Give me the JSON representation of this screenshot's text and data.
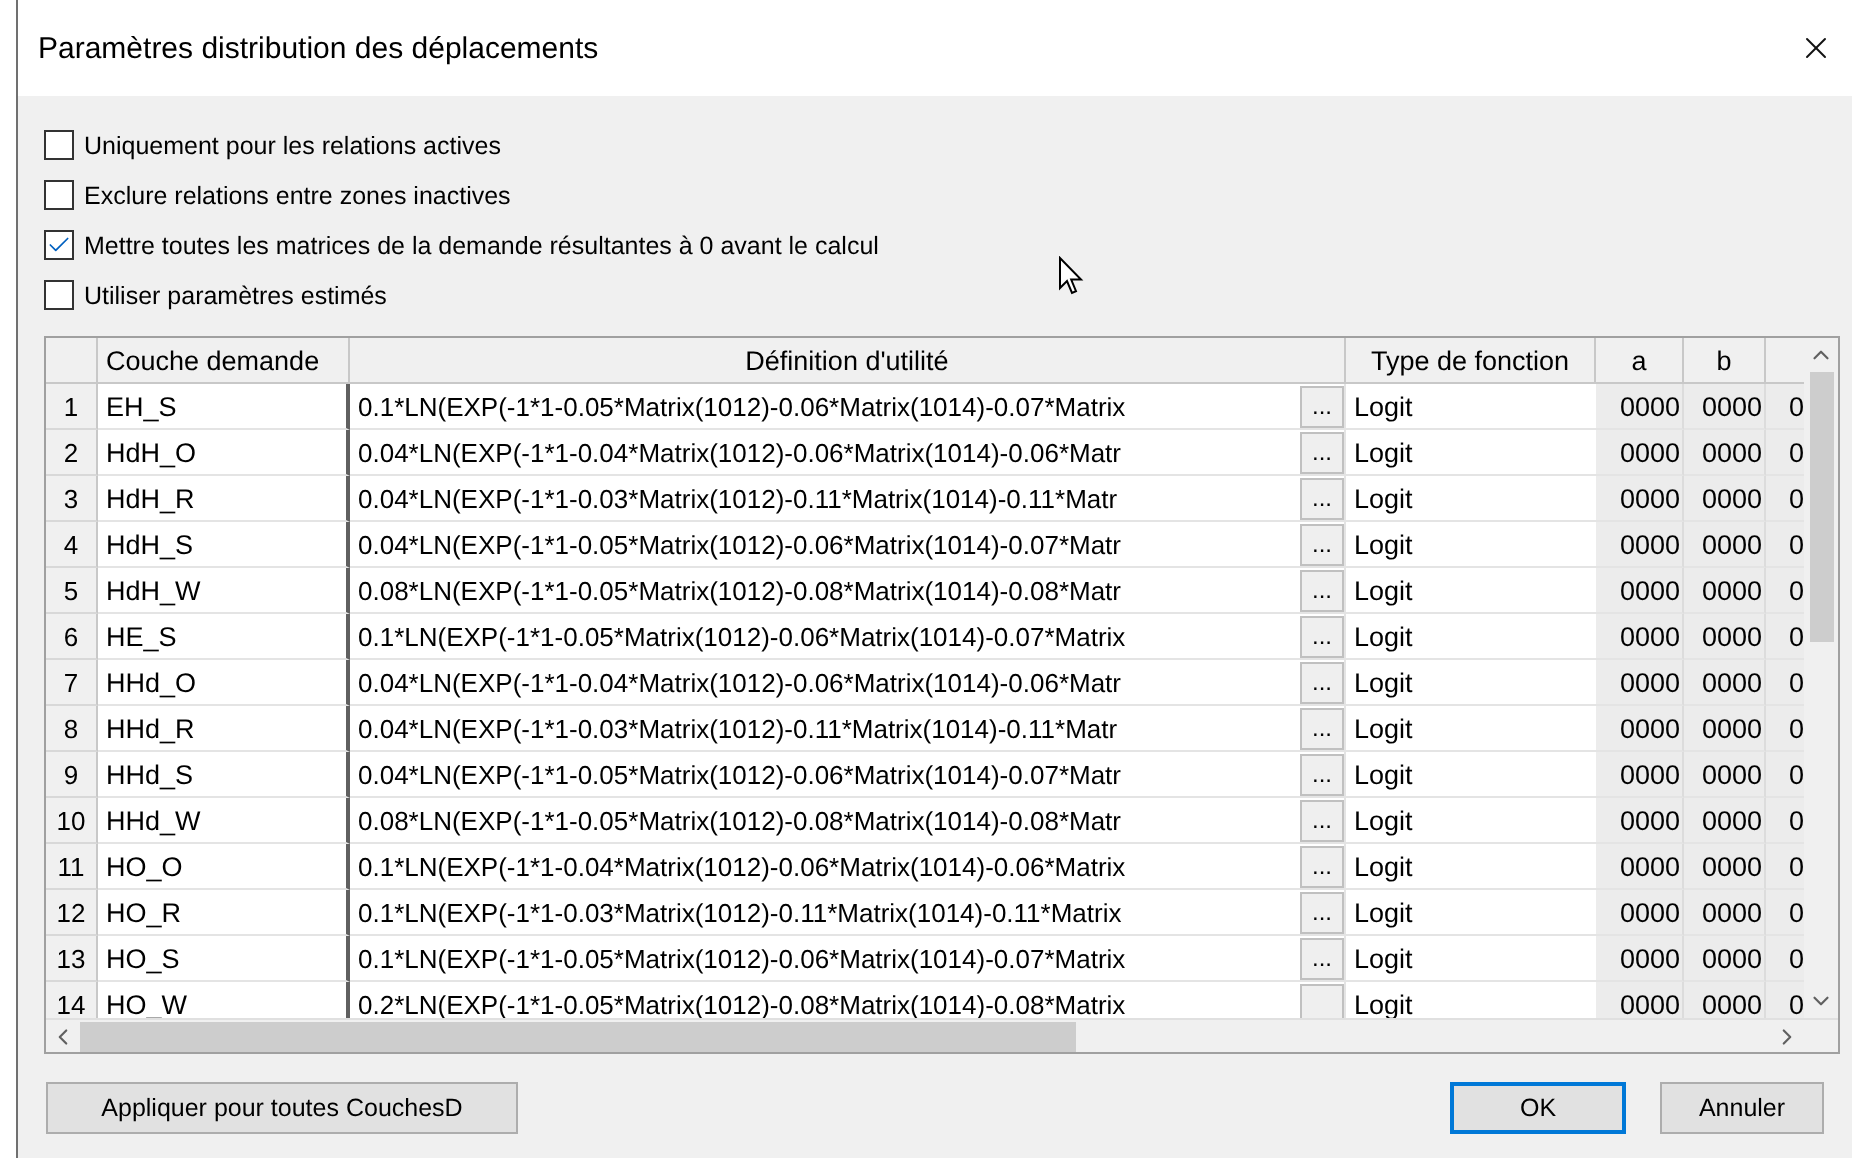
{
  "window": {
    "title": "Paramètres distribution des déplacements"
  },
  "options": [
    {
      "label": "Uniquement pour les relations actives",
      "checked": false
    },
    {
      "label": "Exclure relations entre zones inactives",
      "checked": false
    },
    {
      "label": "Mettre toutes les matrices de la demande résultantes à 0 avant le calcul",
      "checked": true
    },
    {
      "label": "Utiliser paramètres estimés",
      "checked": false
    }
  ],
  "table": {
    "columns": [
      "Couche demande",
      "Définition d'utilité",
      "Type de fonction",
      "a",
      "b"
    ],
    "rows": [
      {
        "index": "1",
        "layer": "EH_S",
        "utility": "0.1*LN(EXP(-1*1-0.05*Matrix(1012)-0.06*Matrix(1014)-0.07*Matrix",
        "edit_button": "...",
        "function_type": "Logit",
        "a": "0000",
        "b": "0000",
        "column_3": "0"
      },
      {
        "index": "2",
        "layer": "HdH_O",
        "utility": "0.04*LN(EXP(-1*1-0.04*Matrix(1012)-0.06*Matrix(1014)-0.06*Matr",
        "edit_button": "...",
        "function_type": "Logit",
        "a": "0000",
        "b": "0000",
        "column_3": "0"
      },
      {
        "index": "3",
        "layer": "HdH_R",
        "utility": "0.04*LN(EXP(-1*1-0.03*Matrix(1012)-0.11*Matrix(1014)-0.11*Matr",
        "edit_button": "...",
        "function_type": "Logit",
        "a": "0000",
        "b": "0000",
        "column_3": "0"
      },
      {
        "index": "4",
        "layer": "HdH_S",
        "utility": "0.04*LN(EXP(-1*1-0.05*Matrix(1012)-0.06*Matrix(1014)-0.07*Matr",
        "edit_button": "...",
        "function_type": "Logit",
        "a": "0000",
        "b": "0000",
        "column_3": "0"
      },
      {
        "index": "5",
        "layer": "HdH_W",
        "utility": "0.08*LN(EXP(-1*1-0.05*Matrix(1012)-0.08*Matrix(1014)-0.08*Matr",
        "edit_button": "...",
        "function_type": "Logit",
        "a": "0000",
        "b": "0000",
        "column_3": "0"
      },
      {
        "index": "6",
        "layer": "HE_S",
        "utility": "0.1*LN(EXP(-1*1-0.05*Matrix(1012)-0.06*Matrix(1014)-0.07*Matrix",
        "edit_button": "...",
        "function_type": "Logit",
        "a": "0000",
        "b": "0000",
        "column_3": "0"
      },
      {
        "index": "7",
        "layer": "HHd_O",
        "utility": "0.04*LN(EXP(-1*1-0.04*Matrix(1012)-0.06*Matrix(1014)-0.06*Matr",
        "edit_button": "...",
        "function_type": "Logit",
        "a": "0000",
        "b": "0000",
        "column_3": "0"
      },
      {
        "index": "8",
        "layer": "HHd_R",
        "utility": "0.04*LN(EXP(-1*1-0.03*Matrix(1012)-0.11*Matrix(1014)-0.11*Matr",
        "edit_button": "...",
        "function_type": "Logit",
        "a": "0000",
        "b": "0000",
        "column_3": "0"
      },
      {
        "index": "9",
        "layer": "HHd_S",
        "utility": "0.04*LN(EXP(-1*1-0.05*Matrix(1012)-0.06*Matrix(1014)-0.07*Matr",
        "edit_button": "...",
        "function_type": "Logit",
        "a": "0000",
        "b": "0000",
        "column_3": "0"
      },
      {
        "index": "10",
        "layer": "HHd_W",
        "utility": "0.08*LN(EXP(-1*1-0.05*Matrix(1012)-0.08*Matrix(1014)-0.08*Matr",
        "edit_button": "...",
        "function_type": "Logit",
        "a": "0000",
        "b": "0000",
        "column_3": "0"
      },
      {
        "index": "11",
        "layer": "HO_O",
        "utility": "0.1*LN(EXP(-1*1-0.04*Matrix(1012)-0.06*Matrix(1014)-0.06*Matrix",
        "edit_button": "...",
        "function_type": "Logit",
        "a": "0000",
        "b": "0000",
        "column_3": "0"
      },
      {
        "index": "12",
        "layer": "HO_R",
        "utility": "0.1*LN(EXP(-1*1-0.03*Matrix(1012)-0.11*Matrix(1014)-0.11*Matrix",
        "edit_button": "...",
        "function_type": "Logit",
        "a": "0000",
        "b": "0000",
        "column_3": "0"
      },
      {
        "index": "13",
        "layer": "HO_S",
        "utility": "0.1*LN(EXP(-1*1-0.05*Matrix(1012)-0.06*Matrix(1014)-0.07*Matrix",
        "edit_button": "...",
        "function_type": "Logit",
        "a": "0000",
        "b": "0000",
        "column_3": "0"
      },
      {
        "index": "14",
        "layer": "HO_W",
        "utility": "0.2*LN(EXP(-1*1-0.05*Matrix(1012)-0.08*Matrix(1014)-0.08*Matrix",
        "edit_button": "",
        "function_type": "Logit",
        "a": "0000",
        "b": "0000",
        "column_3": "0"
      }
    ]
  },
  "buttons": [
    {
      "label": "Appliquer pour toutes CouchesD",
      "kind": "apply"
    },
    {
      "label": "OK",
      "kind": "default"
    },
    {
      "label": "Annuler",
      "kind": "normal"
    }
  ]
}
